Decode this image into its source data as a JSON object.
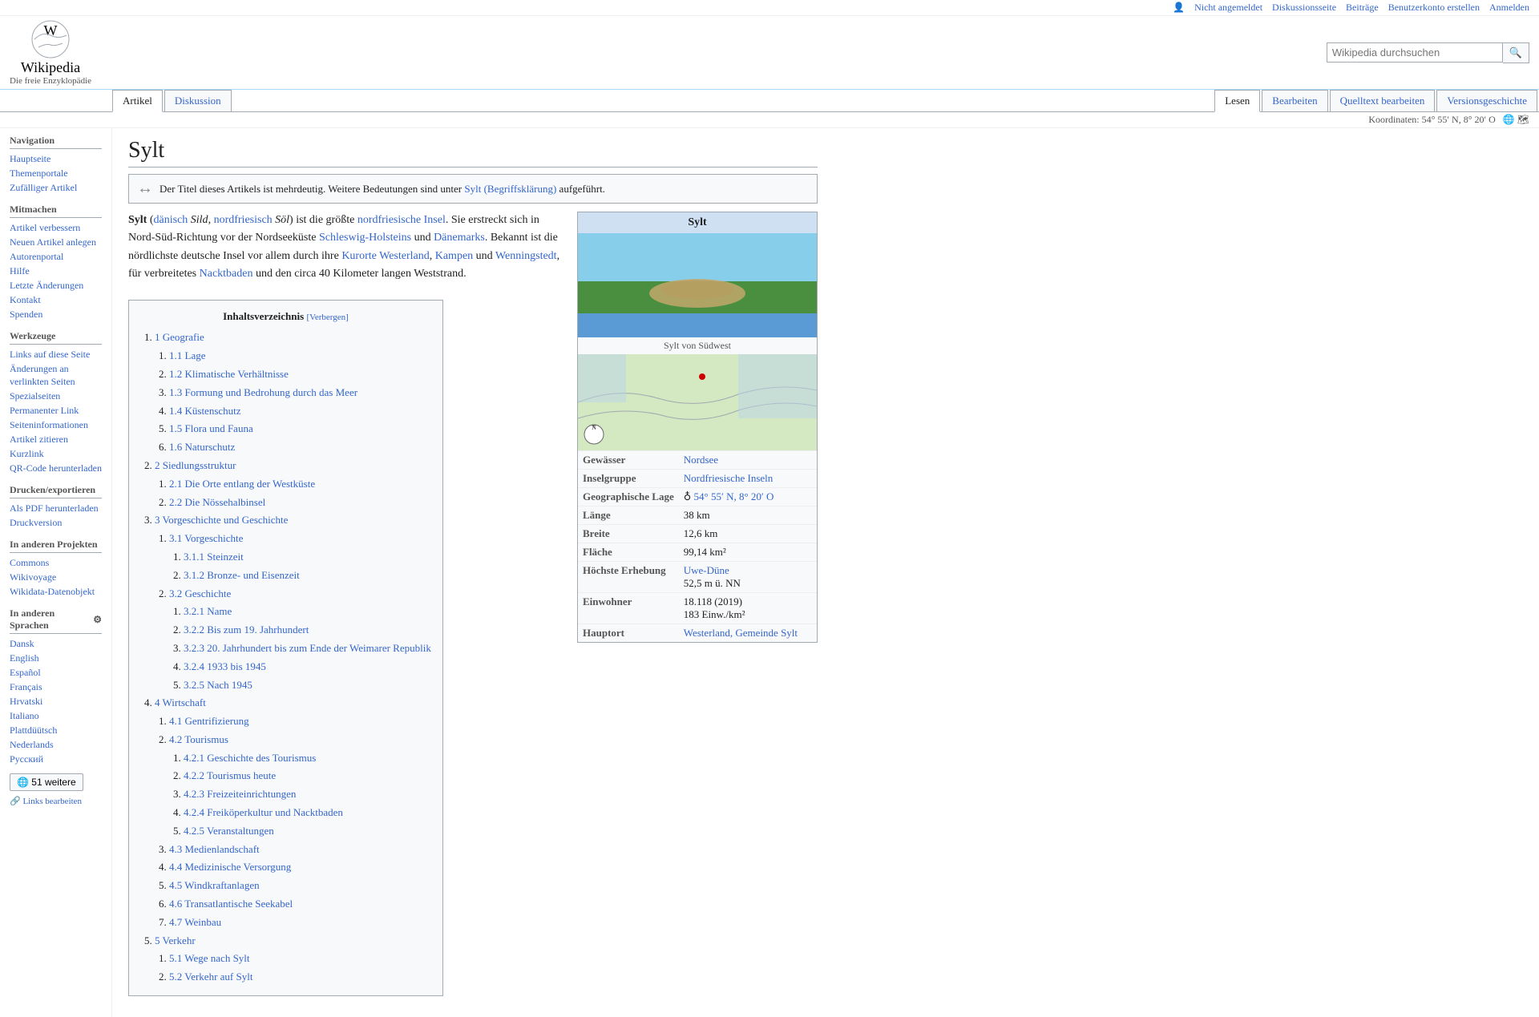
{
  "header": {
    "logo_title": "Wikipedia",
    "logo_subtitle": "Die freie Enzyklopädie",
    "search_placeholder": "Wikipedia durchsuchen",
    "search_button_label": "🔍"
  },
  "top_nav": {
    "not_logged_in": "Nicht angemeldet",
    "discussion": "Diskussionsseite",
    "contributions": "Beiträge",
    "create_account": "Benutzerkonto erstellen",
    "login": "Anmelden"
  },
  "tabs": [
    {
      "label": "Artikel",
      "active": true
    },
    {
      "label": "Diskussion",
      "active": false
    },
    {
      "label": "Lesen",
      "active": true
    },
    {
      "label": "Bearbeiten",
      "active": false
    },
    {
      "label": "Quelltext bearbeiten",
      "active": false
    },
    {
      "label": "Versionsgeschichte",
      "active": false
    }
  ],
  "coords_bar": "Koordinaten: 54° 55′ N, 8° 20′ O",
  "page_title": "Sylt",
  "disambig_notice": "Der Titel dieses Artikels ist mehrdeutig. Weitere Bedeutungen sind unter Sylt (Begriffsklärung) aufgeführt.",
  "article_intro": "Sylt (dänisch Sild, nordfriesisch Söl) ist die größte nordfriesische Insel. Sie erstreckt sich in Nord-Süd-Richtung vor der Nordseeküste Schleswig-Holsteins und Dänemarks. Bekannt ist die nördlichste deutsche Insel vor allem durch ihre Kurorte Westerland, Kampen und Wenningstedt, für verbreitetes Nacktbaden und den circa 40 Kilometer langen Weststrand.",
  "infobox": {
    "title": "Sylt",
    "image_caption": "Sylt von Südwest",
    "rows": [
      {
        "label": "Gewässer",
        "value": "Nordsee"
      },
      {
        "label": "Inselgruppe",
        "value": "Nordfriesische Inseln"
      },
      {
        "label": "Geographische Lage",
        "value": "♁ 54° 55′ N, 8° 20′ O"
      },
      {
        "label": "Länge",
        "value": "38 km"
      },
      {
        "label": "Breite",
        "value": "12,6 km"
      },
      {
        "label": "Fläche",
        "value": "99,14 km²"
      },
      {
        "label": "Höchste Erhebung",
        "value": "Uwe-Düne\n52,5 m ü. NN"
      },
      {
        "label": "Einwohner",
        "value": "18.118 (2019)\n183 Einw./km²"
      },
      {
        "label": "Hauptort",
        "value": "Westerland, Gemeinde Sylt"
      }
    ]
  },
  "toc": {
    "title": "Inhaltsverzeichnis",
    "toggle_label": "[Verbergen]",
    "items": [
      {
        "num": "1",
        "label": "Geografie",
        "sub": [
          {
            "num": "1.1",
            "label": "Lage"
          },
          {
            "num": "1.2",
            "label": "Klimatische Verhältnisse"
          },
          {
            "num": "1.3",
            "label": "Formung und Bedrohung durch das Meer"
          },
          {
            "num": "1.4",
            "label": "Küstenschutz"
          },
          {
            "num": "1.5",
            "label": "Flora und Fauna"
          },
          {
            "num": "1.6",
            "label": "Naturschutz"
          }
        ]
      },
      {
        "num": "2",
        "label": "Siedlungsstruktur",
        "sub": [
          {
            "num": "2.1",
            "label": "Die Orte entlang der Westküste"
          },
          {
            "num": "2.2",
            "label": "Die Nössehalbinsel"
          }
        ]
      },
      {
        "num": "3",
        "label": "Vorgeschichte und Geschichte",
        "sub": [
          {
            "num": "3.1",
            "label": "Vorgeschichte",
            "sub2": [
              {
                "num": "3.1.1",
                "label": "Steinzeit"
              },
              {
                "num": "3.1.2",
                "label": "Bronze- und Eisenzeit"
              }
            ]
          },
          {
            "num": "3.2",
            "label": "Geschichte",
            "sub2": [
              {
                "num": "3.2.1",
                "label": "Name"
              },
              {
                "num": "3.2.2",
                "label": "Bis zum 19. Jahrhundert"
              },
              {
                "num": "3.2.3",
                "label": "20. Jahrhundert bis zum Ende der Weimarer Republik"
              },
              {
                "num": "3.2.4",
                "label": "1933 bis 1945"
              },
              {
                "num": "3.2.5",
                "label": "Nach 1945"
              }
            ]
          }
        ]
      },
      {
        "num": "4",
        "label": "Wirtschaft",
        "sub": [
          {
            "num": "4.1",
            "label": "Gentrifizierung"
          },
          {
            "num": "4.2",
            "label": "Tourismus",
            "sub2": [
              {
                "num": "4.2.1",
                "label": "Geschichte des Tourismus"
              },
              {
                "num": "4.2.2",
                "label": "Tourismus heute"
              },
              {
                "num": "4.2.3",
                "label": "Freizeiteinrichtungen"
              },
              {
                "num": "4.2.4",
                "label": "Freiköperkultur und Nacktbaden"
              },
              {
                "num": "4.2.5",
                "label": "Veranstaltungen"
              }
            ]
          },
          {
            "num": "4.3",
            "label": "Medienlandschaft"
          },
          {
            "num": "4.4",
            "label": "Medizinische Versorgung"
          },
          {
            "num": "4.5",
            "label": "Windkraftanlagen"
          },
          {
            "num": "4.6",
            "label": "Transatlantische Seekabel"
          },
          {
            "num": "4.7",
            "label": "Weinbau"
          }
        ]
      },
      {
        "num": "5",
        "label": "Verkehr",
        "sub": [
          {
            "num": "5.1",
            "label": "Wege nach Sylt"
          },
          {
            "num": "5.2",
            "label": "Verkehr auf Sylt"
          }
        ]
      }
    ]
  },
  "sidebar": {
    "navigation_title": "Navigation",
    "navigation_items": [
      {
        "label": "Hauptseite"
      },
      {
        "label": "Themenportale"
      },
      {
        "label": "Zufälliger Artikel"
      }
    ],
    "mitmachen_title": "Mitmachen",
    "mitmachen_items": [
      {
        "label": "Artikel verbessern"
      },
      {
        "label": "Neuen Artikel anlegen"
      },
      {
        "label": "Autorenportal"
      },
      {
        "label": "Hilfe"
      },
      {
        "label": "Letzte Änderungen"
      },
      {
        "label": "Kontakt"
      },
      {
        "label": "Spenden"
      }
    ],
    "werkzeuge_title": "Werkzeuge",
    "werkzeuge_items": [
      {
        "label": "Links auf diese Seite"
      },
      {
        "label": "Änderungen an verlinkten Seiten"
      },
      {
        "label": "Spezialseiten"
      },
      {
        "label": "Permanenter Link"
      },
      {
        "label": "Seiteninformationen"
      },
      {
        "label": "Artikel zitieren"
      },
      {
        "label": "Kurzlink"
      },
      {
        "label": "QR-Code herunterladen"
      }
    ],
    "drucken_title": "Drucken/exportieren",
    "drucken_items": [
      {
        "label": "Als PDF herunterladen"
      },
      {
        "label": "Druckversion"
      }
    ],
    "andere_projekte_title": "In anderen Projekten",
    "andere_projekte_items": [
      {
        "label": "Commons"
      },
      {
        "label": "Wikivoyage"
      },
      {
        "label": "Wikidata-Datenobjekt"
      }
    ],
    "andere_sprachen_title": "In anderen Sprachen",
    "andere_sprachen_items": [
      {
        "label": "Dansk"
      },
      {
        "label": "English"
      },
      {
        "label": "Español"
      },
      {
        "label": "Français"
      },
      {
        "label": "Hrvatski"
      },
      {
        "label": "Italiano"
      },
      {
        "label": "Plattdüütsch"
      },
      {
        "label": "Nederlands"
      },
      {
        "label": "Русский"
      }
    ],
    "weitere_sprachen_label": "51 weitere",
    "links_bearbeiten_label": "Links bearbeiten"
  }
}
